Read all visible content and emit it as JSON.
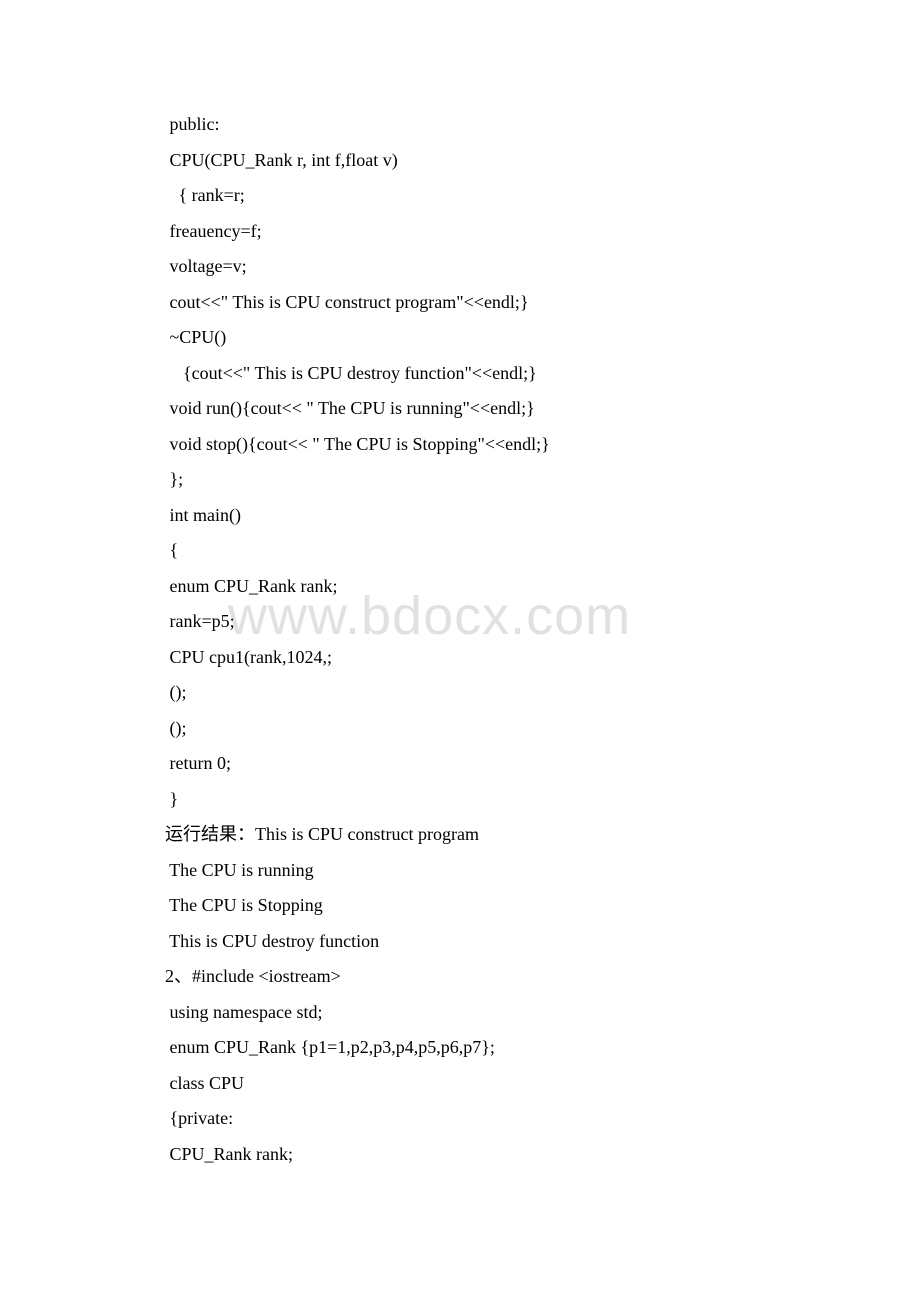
{
  "watermark": "www.bdocx.com",
  "lines": [
    " public:",
    " CPU(CPU_Rank r, int f,float v)",
    "   { rank=r;",
    " freauency=f;",
    " voltage=v;",
    " cout<<\" This is CPU construct program\"<<endl;}",
    " ~CPU()",
    "    {cout<<\" This is CPU destroy function\"<<endl;}",
    " void run(){cout<< \" The CPU is running\"<<endl;}",
    " void stop(){cout<< \" The CPU is Stopping\"<<endl;}",
    " };",
    " int main()",
    " {",
    " enum CPU_Rank rank;",
    " rank=p5;",
    " CPU cpu1(rank,1024,;",
    " ();",
    " ();",
    " return 0;",
    " }",
    "运行结果：This is CPU construct program",
    " The CPU is running",
    " The CPU is Stopping",
    " This is CPU destroy function",
    "2、#include <iostream>",
    " using namespace std;",
    " enum CPU_Rank {p1=1,p2,p3,p4,p5,p6,p7};",
    " class CPU",
    " {private:",
    " CPU_Rank rank;"
  ]
}
